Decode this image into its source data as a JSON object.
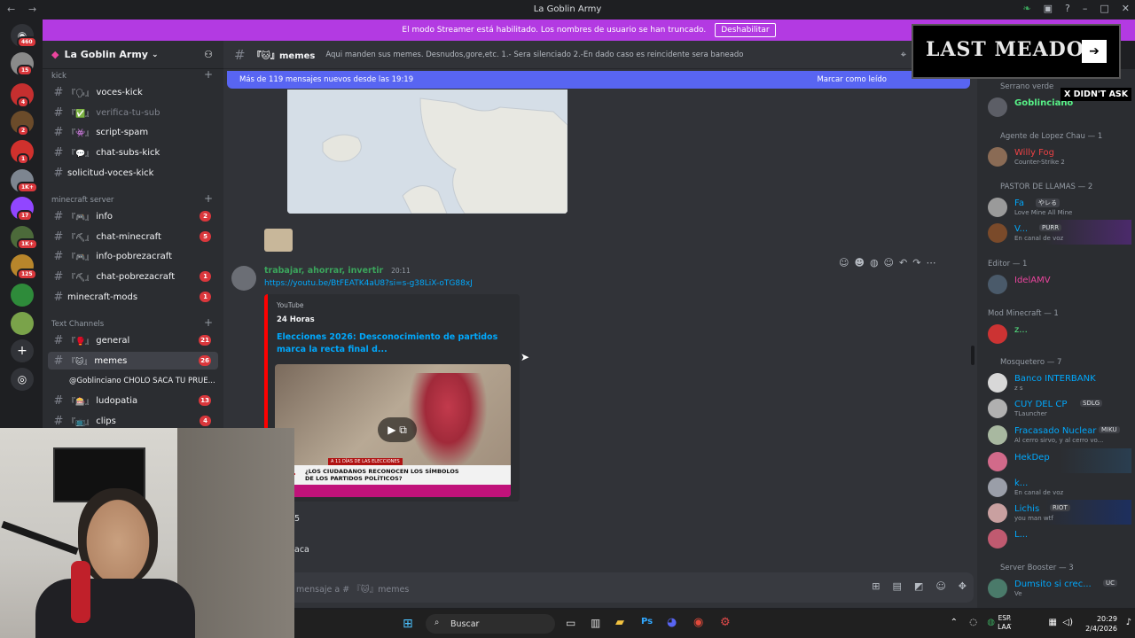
{
  "window": {
    "title": "La Goblin Army"
  },
  "banner": {
    "text": "El modo Streamer está habilitado. Los nombres de usuario se han truncado.",
    "button": "Deshabilitar"
  },
  "server": {
    "name": "La Goblin Army"
  },
  "rail_badges": [
    "460",
    "15",
    "4",
    "2",
    "1",
    "1K+",
    "17",
    "1K+",
    "125"
  ],
  "categories": {
    "kick": "kick",
    "minecraft": "minecraft server",
    "text": "Text Channels"
  },
  "channels": [
    {
      "pre": "『🗣』",
      "name": "voces-kick",
      "count": ""
    },
    {
      "pre": "『✅』",
      "name": "verifica-tu-sub",
      "count": ""
    },
    {
      "pre": "『👾』",
      "name": "script-spam",
      "count": ""
    },
    {
      "pre": "『💬』",
      "name": "chat-subs-kick",
      "count": ""
    },
    {
      "pre": "",
      "name": "solicitud-voces-kick",
      "count": ""
    },
    {
      "pre": "『🎮』",
      "name": "info",
      "count": "2"
    },
    {
      "pre": "『⛏』",
      "name": "chat-minecraft",
      "count": "5"
    },
    {
      "pre": "『🎮』",
      "name": "info-pobrezacraft",
      "count": ""
    },
    {
      "pre": "『⛏』",
      "name": "chat-pobrezacraft",
      "count": "1"
    },
    {
      "pre": "",
      "name": "minecraft-mods",
      "count": "1"
    },
    {
      "pre": "『🥊』",
      "name": "general",
      "count": "21"
    },
    {
      "pre": "『🐱』",
      "name": "memes",
      "count": "26"
    },
    {
      "pre": "『🎰』",
      "name": "ludopatia",
      "count": "13"
    },
    {
      "pre": "『📺』",
      "name": "clips",
      "count": "4"
    }
  ],
  "thread": "@Goblinciano CHOLO SACA TU PRUE...",
  "header": {
    "channel": "『🐱』memes",
    "topic": "Aqui manden sus memes. Desnudos,gore,etc. 1.- Sera silenciado 2.-En dado caso es reincidente sera baneado"
  },
  "newbar": {
    "left": "Más de 119 mensajes nuevos desde las 19:19",
    "right": "Marcar como leído"
  },
  "message": {
    "author": "trabajar, ahorrar, invertir",
    "time": "20:11",
    "link": "https://youtu.be/BtFEATK4aU8?si=s-g38LiX-oTG88xJ",
    "embed": {
      "provider": "YouTube",
      "author": "24 Horas",
      "title": "Elecciones 2026: Desconocimiento de partidos marca la recta final d...",
      "caption": "¿LOS CIUDADANOS RECONOCEN LOS SÍMBOLOS DE LOS PARTIDOS POLÍTICOS?",
      "logo": "24",
      "ticker": "A 11 DÍAS DE LAS ELECCIONES"
    },
    "frag1": "5",
    "frag2": "aca"
  },
  "composer": {
    "placeholder": "mensaje a # 『🐱』memes"
  },
  "members": {
    "groups": [
      {
        "label": "Serrano verde"
      },
      {
        "label": "Agente de Lopez Chau — 1"
      },
      {
        "label": "PASTOR DE LLAMAS — 2"
      },
      {
        "label": "Editor — 1"
      },
      {
        "label": "Mod Minecraft — 1"
      },
      {
        "label": "Mosquetero — 7"
      },
      {
        "label": "Server Booster — 3"
      }
    ],
    "list": [
      {
        "name": "Goblinciano",
        "status": "",
        "color": "#57f287"
      },
      {
        "name": "Willy Fog",
        "status": "Counter-Strike 2",
        "color": "#ed4245"
      },
      {
        "name": "Fa",
        "status": "Love Mine All Mine",
        "color": "#00a8fc"
      },
      {
        "name": "V...",
        "status": "En canal de voz",
        "color": "#00a8fc"
      },
      {
        "name": "IdelAMV",
        "status": "",
        "color": "#eb459e"
      },
      {
        "name": "z...",
        "status": "",
        "color": "#57f287"
      },
      {
        "name": "Banco INTERBANK",
        "status": "z s",
        "color": "#00a8fc"
      },
      {
        "name": "CUY DEL CP",
        "status": "TLauncher",
        "color": "#00a8fc"
      },
      {
        "name": "Fracasado Nuclear",
        "status": "Al cerro sirvo, y al cerro vo...",
        "color": "#00a8fc"
      },
      {
        "name": "HekDep",
        "status": "",
        "color": "#00a8fc"
      },
      {
        "name": "k...",
        "status": "En canal de voz",
        "color": "#00a8fc"
      },
      {
        "name": "Lichis",
        "status": "you man wtf",
        "color": "#00a8fc"
      },
      {
        "name": "L...",
        "status": "",
        "color": "#00a8fc"
      },
      {
        "name": "Dumsito si crec...",
        "status": "Ve",
        "color": "#00a8fc"
      }
    ],
    "tags": {
      "fa": "やレる",
      "v": "PURR",
      "cuy": "SDLG",
      "fracasado": "MIKU",
      "lichis": "RIOT",
      "dumsito": "UC"
    }
  },
  "overlay": {
    "title": "LAST MEADOW",
    "caption": "X DIDN'T ASK"
  },
  "taskbar": {
    "search": "Buscar",
    "lang1": "ESP",
    "lang2": "LAA",
    "time": "20:29",
    "date": "2/4/2026"
  }
}
